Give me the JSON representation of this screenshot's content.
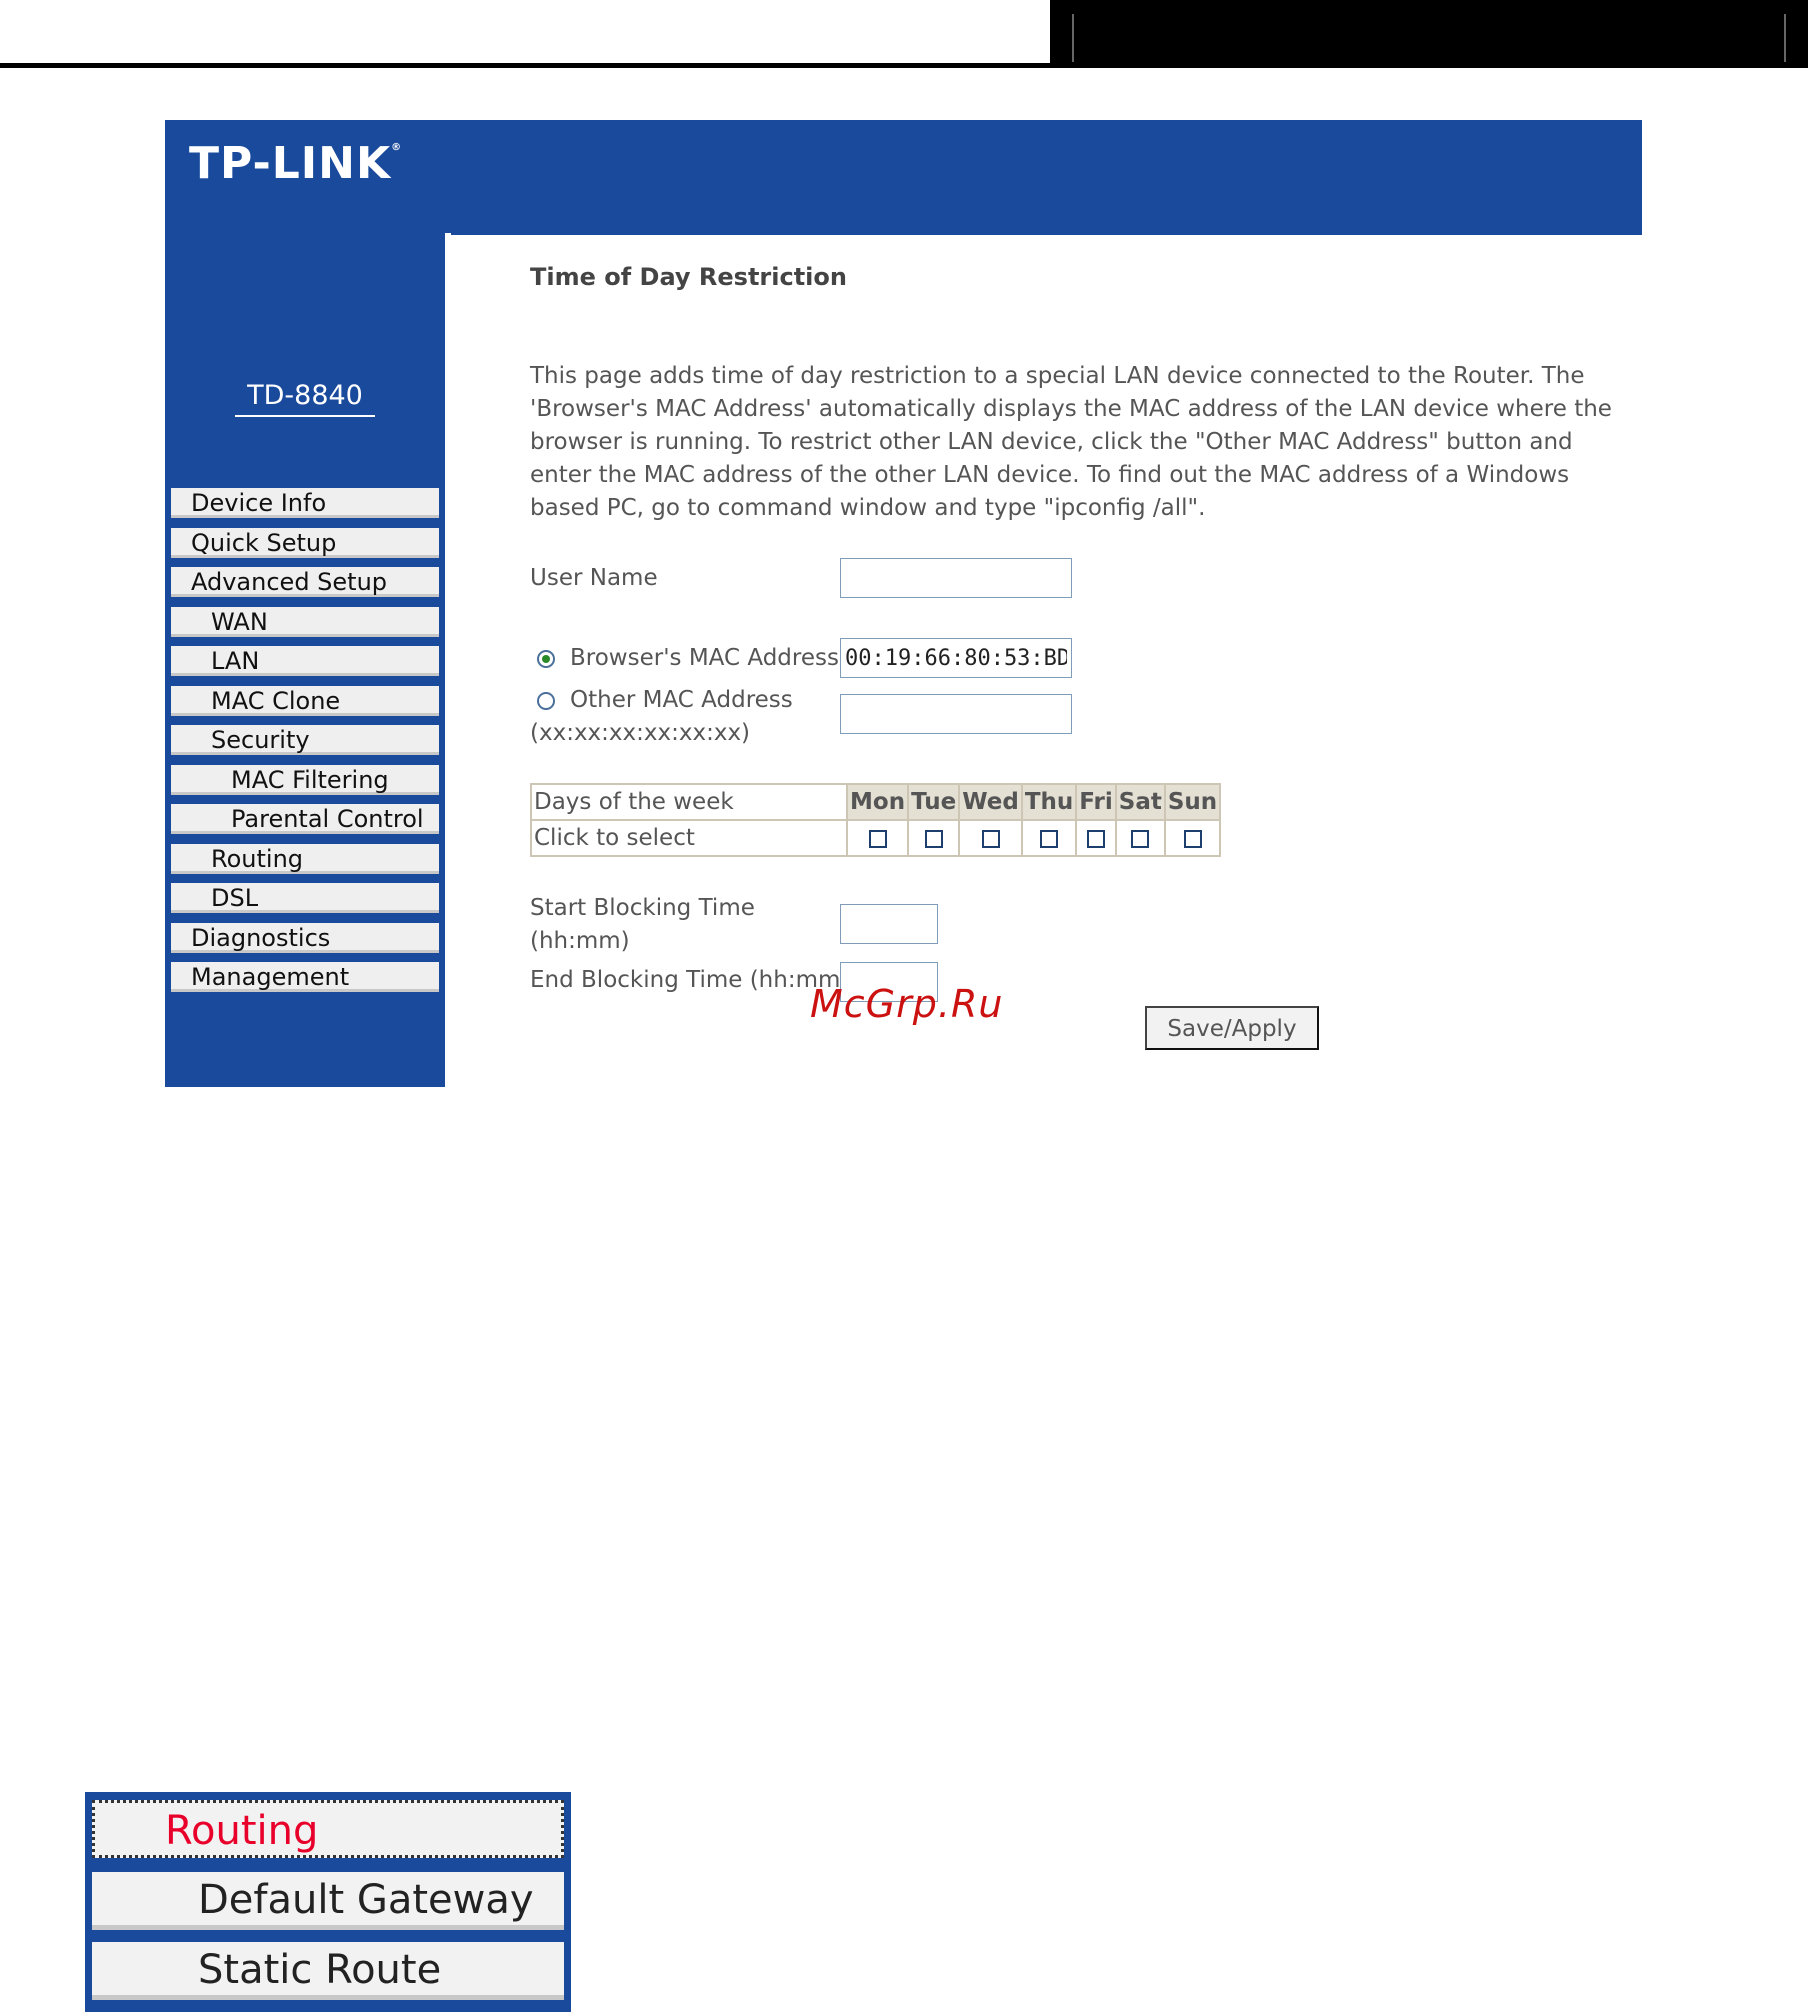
{
  "brand": {
    "logo_text": "TP-LINK",
    "logo_mark": "®",
    "model": "TD-8840"
  },
  "sidebar": {
    "items": [
      {
        "label": "Device Info",
        "level": 0
      },
      {
        "label": "Quick Setup",
        "level": 0
      },
      {
        "label": "Advanced Setup",
        "level": 0
      },
      {
        "label": "WAN",
        "level": 1
      },
      {
        "label": "LAN",
        "level": 1
      },
      {
        "label": "MAC Clone",
        "level": 1
      },
      {
        "label": "Security",
        "level": 1
      },
      {
        "label": "MAC Filtering",
        "level": 2
      },
      {
        "label": "Parental Control",
        "level": 2
      },
      {
        "label": "Routing",
        "level": 1
      },
      {
        "label": "DSL",
        "level": 1
      },
      {
        "label": "Diagnostics",
        "level": 0
      },
      {
        "label": "Management",
        "level": 0
      }
    ]
  },
  "main": {
    "title": "Time of Day Restriction",
    "description": "This page adds time of day restriction to a special LAN device connected to the Router. The 'Browser's MAC Address' automatically displays the MAC address of the LAN device where the browser is running. To restrict other LAN device, click the \"Other MAC Address\" button and enter the MAC address of the other LAN device. To find out the MAC address of a Windows based PC, go to command window and type \"ipconfig /all\".",
    "user_name_label": "User Name",
    "user_name_value": "",
    "browser_mac_label": "Browser's MAC Address",
    "browser_mac_value": "00:19:66:80:53:BD",
    "browser_mac_selected": true,
    "other_mac_label": "Other MAC Address",
    "other_mac_hint": "(xx:xx:xx:xx:xx:xx)",
    "other_mac_value": "",
    "days_header_label": "Days of the week",
    "days_select_label": "Click to select",
    "days": [
      "Mon",
      "Tue",
      "Wed",
      "Thu",
      "Fri",
      "Sat",
      "Sun"
    ],
    "days_checked": [
      false,
      false,
      false,
      false,
      false,
      false,
      false
    ],
    "start_label_line1": "Start Blocking Time",
    "start_label_line2": "(hh:mm)",
    "start_value": "",
    "end_label": "End Blocking Time (hh:mm)",
    "end_value": "",
    "save_button": "Save/Apply"
  },
  "watermark": "McGrp.Ru",
  "routing_menu": {
    "items": [
      "Routing",
      "Default Gateway",
      "Static Route"
    ],
    "highlight_color": "#e8002a"
  },
  "colors": {
    "brand_blue": "#1a4a9c",
    "nav_bg": "#efefef",
    "table_header": "#e4e0d4"
  }
}
